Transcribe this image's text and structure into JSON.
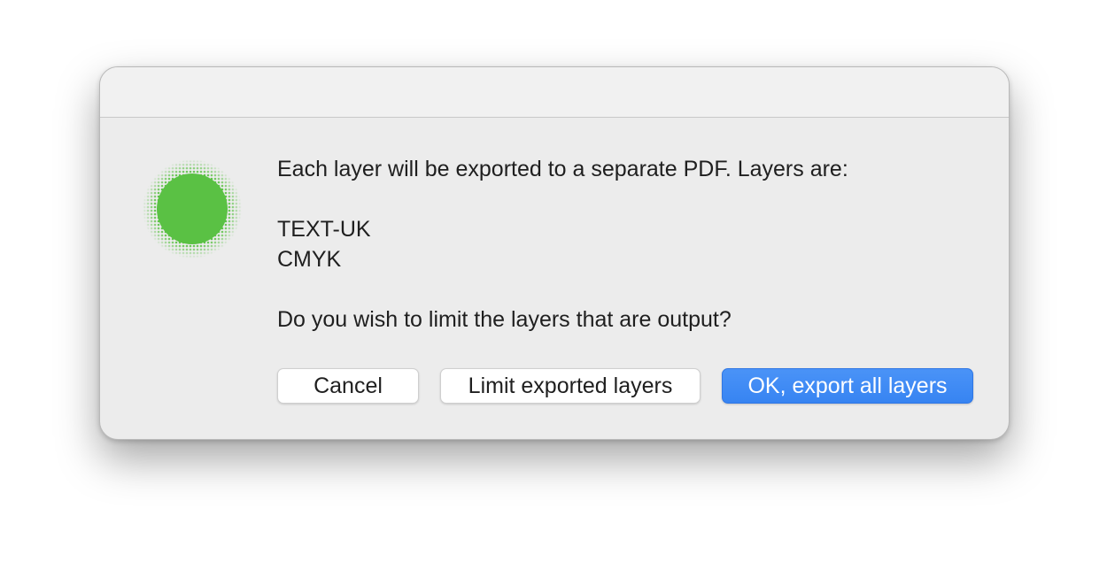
{
  "dialog": {
    "icon": "green-halftone-circle-icon",
    "colors": {
      "icon_green": "#5ac144",
      "primary_button": "#3b87f4",
      "background": "#ececec"
    },
    "message_intro": "Each layer will be exported to a separate PDF. Layers are:",
    "layers": [
      "TEXT-UK",
      "CMYK"
    ],
    "question": "Do you wish to limit the layers that are output?",
    "buttons": {
      "cancel": "Cancel",
      "limit": "Limit exported layers",
      "ok": "OK, export all layers"
    }
  }
}
